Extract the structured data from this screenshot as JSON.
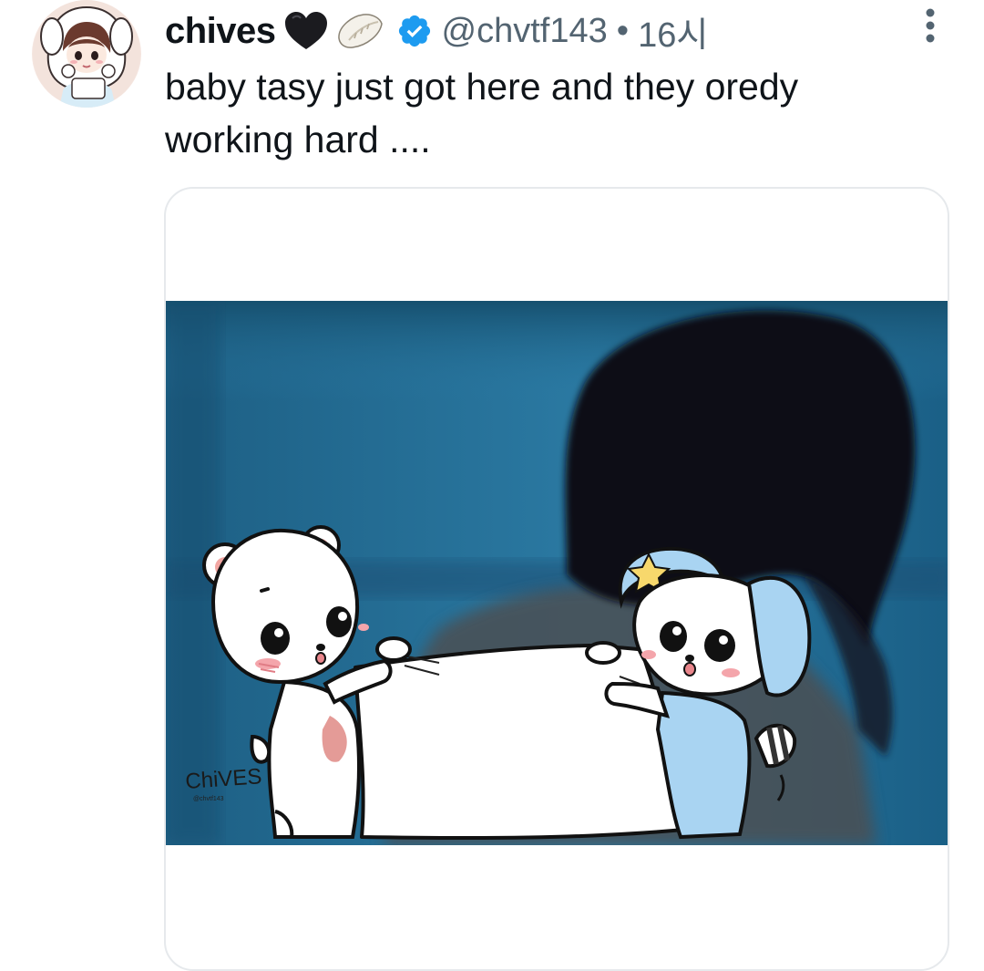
{
  "tweet": {
    "display_name": "chives",
    "handle": "@chvtf143",
    "separator": "•",
    "time": "16시",
    "text": "baby tasy just got here and they oredy working hard ....",
    "verified": true,
    "name_emojis": [
      "black-heart-icon",
      "dumpling-icon"
    ]
  },
  "media": {
    "watermark": "ChiVES",
    "watermark_sub": "@chvtf143"
  },
  "colors": {
    "text_primary": "#0f1419",
    "text_secondary": "#536471",
    "verified_blue": "#1d9bf0",
    "card_border": "#e6e9ec"
  }
}
